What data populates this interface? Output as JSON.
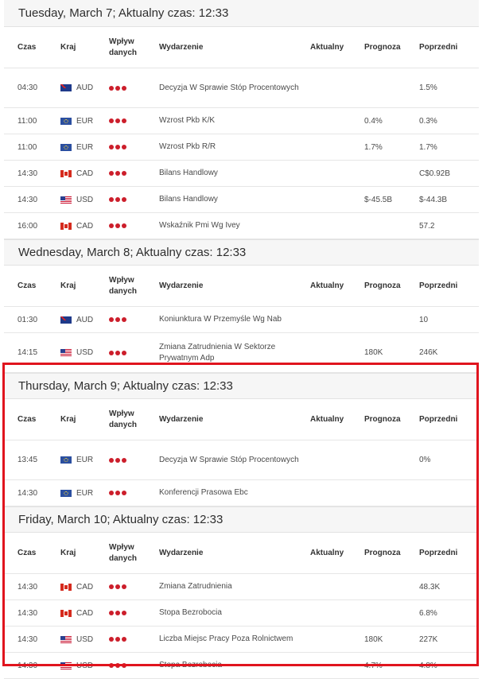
{
  "columns": {
    "time": "Czas",
    "country": "Kraj",
    "impact_line1": "Wpływ",
    "impact_line2": "danych",
    "event": "Wydarzenie",
    "actual": "Aktualny",
    "forecast": "Prognoza",
    "previous": "Poprzedni"
  },
  "accent_color": "#cc1e2b",
  "highlight_color": "#e0141e",
  "days": [
    {
      "title": "Tuesday, March 7; Aktualny czas: 12:33",
      "events": [
        {
          "time": "04:30",
          "flag": "au-flag-icon",
          "country": "AUD",
          "impact": 3,
          "event": "Decyzja W Sprawie Stóp Procentowych",
          "actual": "",
          "forecast": "",
          "previous": "1.5%"
        },
        {
          "time": "11:00",
          "flag": "eu-flag-icon",
          "country": "EUR",
          "impact": 3,
          "event": "Wzrost Pkb K/K",
          "actual": "",
          "forecast": "0.4%",
          "previous": "0.3%"
        },
        {
          "time": "11:00",
          "flag": "eu-flag-icon",
          "country": "EUR",
          "impact": 3,
          "event": "Wzrost Pkb R/R",
          "actual": "",
          "forecast": "1.7%",
          "previous": "1.7%"
        },
        {
          "time": "14:30",
          "flag": "ca-flag-icon",
          "country": "CAD",
          "impact": 3,
          "event": "Bilans Handlowy",
          "actual": "",
          "forecast": "",
          "previous": "C$0.92B"
        },
        {
          "time": "14:30",
          "flag": "us-flag-icon",
          "country": "USD",
          "impact": 3,
          "event": "Bilans Handlowy",
          "actual": "",
          "forecast": "$-45.5B",
          "previous": "$-44.3B"
        },
        {
          "time": "16:00",
          "flag": "ca-flag-icon",
          "country": "CAD",
          "impact": 3,
          "event": "Wskaźnik Pmi Wg Ivey",
          "actual": "",
          "forecast": "",
          "previous": "57.2"
        }
      ]
    },
    {
      "title": "Wednesday, March 8; Aktualny czas: 12:33",
      "events": [
        {
          "time": "01:30",
          "flag": "au-flag-icon",
          "country": "AUD",
          "impact": 3,
          "event": "Koniunktura W Przemyśle Wg Nab",
          "actual": "",
          "forecast": "",
          "previous": "10"
        },
        {
          "time": "14:15",
          "flag": "us-flag-icon",
          "country": "USD",
          "impact": 3,
          "event": "Zmiana Zatrudnienia W Sektorze Prywatnym Adp",
          "actual": "",
          "forecast": "180K",
          "previous": "246K"
        }
      ]
    },
    {
      "title": "Thursday, March 9; Aktualny czas: 12:33",
      "events": [
        {
          "time": "13:45",
          "flag": "eu-flag-icon",
          "country": "EUR",
          "impact": 3,
          "event": "Decyzja W Sprawie Stóp Procentowych",
          "actual": "",
          "forecast": "",
          "previous": "0%"
        },
        {
          "time": "14:30",
          "flag": "eu-flag-icon",
          "country": "EUR",
          "impact": 3,
          "event": "Konferencji Prasowa Ebc",
          "actual": "",
          "forecast": "",
          "previous": ""
        }
      ]
    },
    {
      "title": "Friday, March 10; Aktualny czas: 12:33",
      "events": [
        {
          "time": "14:30",
          "flag": "ca-flag-icon",
          "country": "CAD",
          "impact": 3,
          "event": "Zmiana Zatrudnienia",
          "actual": "",
          "forecast": "",
          "previous": "48.3K"
        },
        {
          "time": "14:30",
          "flag": "ca-flag-icon",
          "country": "CAD",
          "impact": 3,
          "event": "Stopa Bezrobocia",
          "actual": "",
          "forecast": "",
          "previous": "6.8%"
        },
        {
          "time": "14:30",
          "flag": "us-flag-icon",
          "country": "USD",
          "impact": 3,
          "event": "Liczba Miejsc Pracy Poza Rolnictwem",
          "actual": "",
          "forecast": "180K",
          "previous": "227K"
        },
        {
          "time": "14:30",
          "flag": "us-flag-icon",
          "country": "USD",
          "impact": 3,
          "event": "Stopa Bezrobocia",
          "actual": "",
          "forecast": "4.7%",
          "previous": "4.8%"
        }
      ]
    }
  ]
}
